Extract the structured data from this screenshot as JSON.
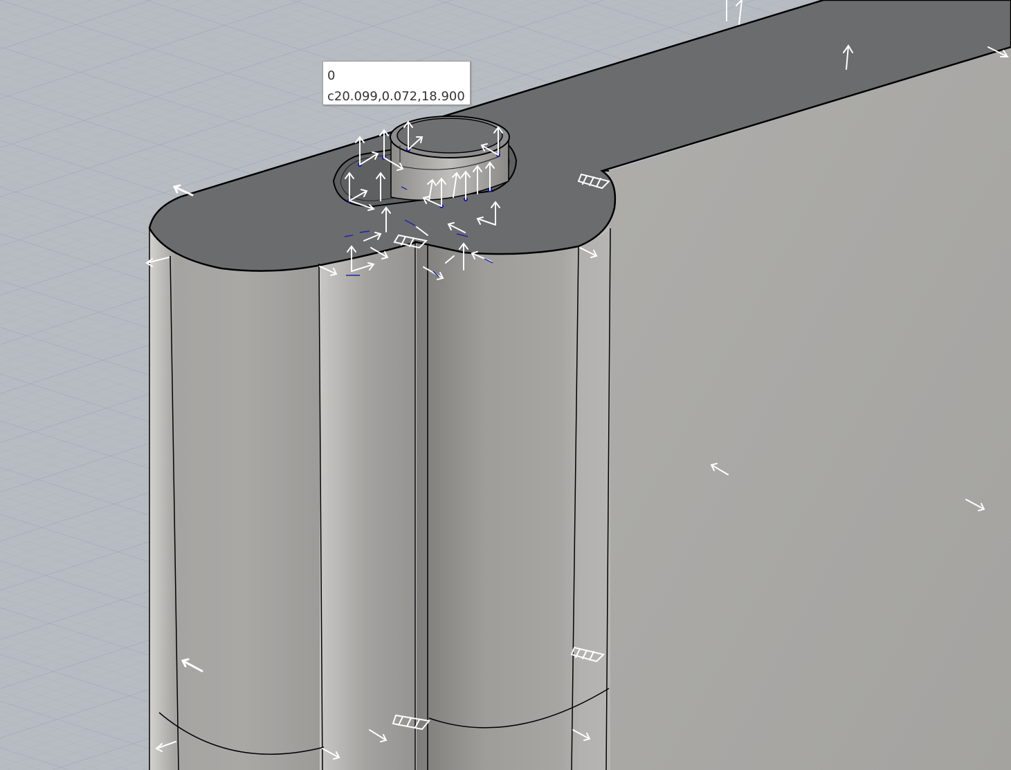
{
  "viewport": {
    "name": "perspective-viewport",
    "background_color": "#b7bcc3",
    "grid_minor_color": "#a9aeb6",
    "grid_major_color": "#9ea4ad",
    "shaded_face_color": "#a8a7a4",
    "top_face_color": "#6b6c6e",
    "edge_color": "#000000",
    "normal_arrow_color": "#ffffff",
    "control_point_color": "#1a1aa8"
  },
  "tooltip": {
    "line1": "0",
    "line2": "c20.099,0.072,18.900"
  }
}
